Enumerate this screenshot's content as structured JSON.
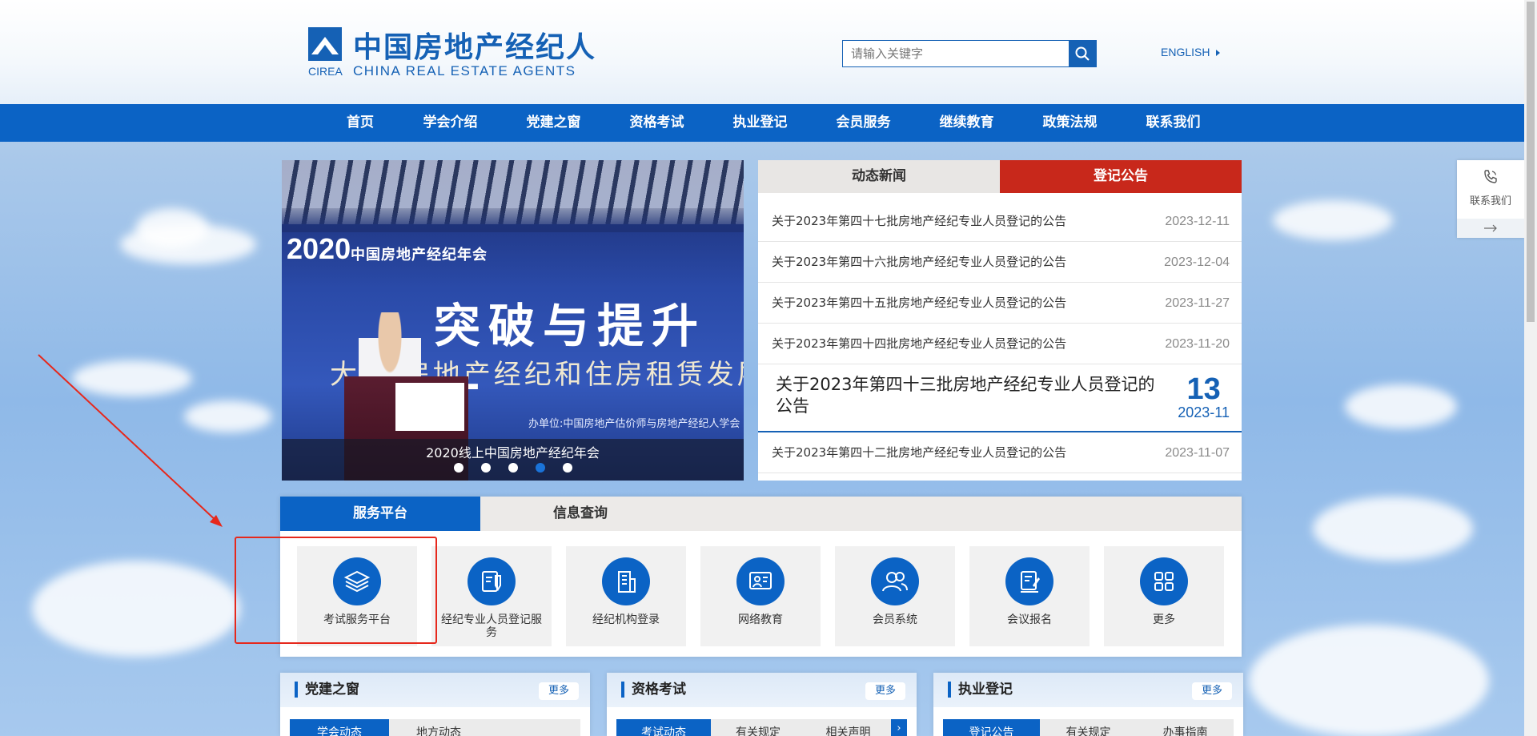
{
  "header": {
    "logo_cn": "中国房地产经纪人",
    "logo_abbr": "CIREA",
    "logo_en": "CHINA REAL ESTATE AGENTS",
    "search_placeholder": "请输入关键字",
    "english_label": "ENGLISH"
  },
  "nav": {
    "items": [
      "首页",
      "学会介绍",
      "党建之窗",
      "资格考试",
      "执业登记",
      "会员服务",
      "继续教育",
      "政策法规",
      "联系我们"
    ]
  },
  "side_contact": {
    "label": "联系我们"
  },
  "banner": {
    "headline_year": "2020",
    "headline_org": "中国房地产经纪年会",
    "big_text": "突破与提升—",
    "sub_text": "大  下房地产经纪和住房租赁发展",
    "organizer_text": "办单位:中国房地产估价师与房地产经纪人学会",
    "caption": "2020线上中国房地产经纪年会",
    "slide_count": 5,
    "active_slide": 4
  },
  "news": {
    "tabs": [
      "动态新闻",
      "登记公告"
    ],
    "active_tab": 1,
    "items_top": [
      {
        "title": "关于2023年第四十七批房地产经纪专业人员登记的公告",
        "date": "2023-12-11"
      },
      {
        "title": "关于2023年第四十六批房地产经纪专业人员登记的公告",
        "date": "2023-12-04"
      },
      {
        "title": "关于2023年第四十五批房地产经纪专业人员登记的公告",
        "date": "2023-11-27"
      },
      {
        "title": "关于2023年第四十四批房地产经纪专业人员登记的公告",
        "date": "2023-11-20"
      }
    ],
    "featured": {
      "title": "关于2023年第四十三批房地产经纪专业人员登记的公告",
      "day": "13",
      "year_month": "2023-11"
    },
    "items_bottom": [
      {
        "title": "关于2023年第四十二批房地产经纪专业人员登记的公告",
        "date": "2023-11-07"
      }
    ]
  },
  "service": {
    "tabs": [
      "服务平台",
      "信息查询"
    ],
    "active_tab": 0,
    "items": [
      {
        "label": "考试服务平台",
        "icon": "layers-icon"
      },
      {
        "label": "经纪专业人员登记服务",
        "icon": "document-pen-icon"
      },
      {
        "label": "经纪机构登录",
        "icon": "building-icon"
      },
      {
        "label": "网络教育",
        "icon": "online-education-icon"
      },
      {
        "label": "会员系统",
        "icon": "users-icon"
      },
      {
        "label": "会议报名",
        "icon": "signup-icon"
      },
      {
        "label": "更多",
        "icon": "grid-icon"
      }
    ]
  },
  "panels": [
    {
      "title": "党建之窗",
      "more": "更多",
      "tabs": [
        "学会动态",
        "地方动态"
      ]
    },
    {
      "title": "资格考试",
      "more": "更多",
      "tabs": [
        "考试动态",
        "有关规定",
        "相关声明"
      ]
    },
    {
      "title": "执业登记",
      "more": "更多",
      "tabs": [
        "登记公告",
        "有关规定",
        "办事指南"
      ]
    }
  ],
  "colors": {
    "brand_blue": "#0b63c5",
    "announcement_red": "#c8281b",
    "annotation_red": "#e6281c"
  }
}
